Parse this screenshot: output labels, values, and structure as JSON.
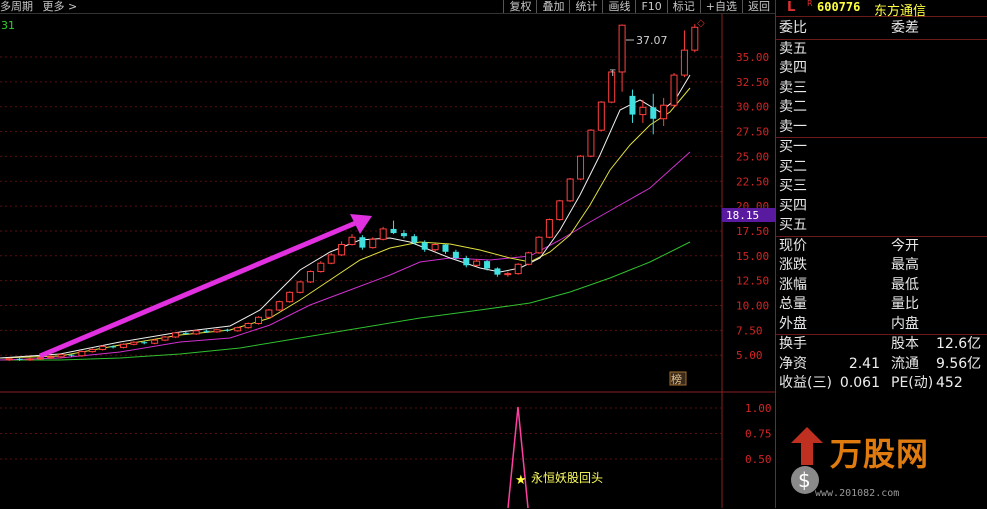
{
  "toolbar": {
    "left": [
      "多周期",
      "更多 >"
    ],
    "buttons": [
      "复权",
      "叠加",
      "统计",
      "画线",
      "F10",
      "标记",
      "+自选",
      "返回"
    ]
  },
  "chart_label_top": "31",
  "price_axis": [
    "35.00",
    "32.50",
    "30.00",
    "27.50",
    "25.00",
    "22.50",
    "20.00",
    "17.50",
    "15.00",
    "12.50",
    "10.00",
    "7.50",
    "5.00"
  ],
  "current_price_tag": "18.15",
  "high_annotation": "37.07",
  "t_marker": "T",
  "bang_badge": "榜",
  "indicator_axis": [
    "1.00",
    "0.75",
    "0.50"
  ],
  "signal_text": "永恒妖股回头",
  "colors": {
    "up_candle": "#ff4040",
    "down_candle": "#40e0e0",
    "ma5": "#ffffff",
    "ma10": "#ffff40",
    "ma20": "#ff40ff",
    "ma60": "#40d040",
    "arrow": "#e030e0",
    "signal": "#ff40a0"
  },
  "chart_data": {
    "type": "candlestick",
    "y_range": [
      4.5,
      37.5
    ],
    "ma_lines": [
      "white",
      "yellow",
      "magenta",
      "green"
    ],
    "indicator_range": [
      0.4,
      1.05
    ],
    "indicator_peak": 1.0
  },
  "panel": {
    "label_L": "L",
    "label_R": "R",
    "code": "600776",
    "name": "东方通信",
    "header_row": {
      "left": "委比",
      "mid": "委差"
    },
    "asks": [
      "卖五",
      "卖四",
      "卖三",
      "卖二",
      "卖一"
    ],
    "bids": [
      "买一",
      "买二",
      "买三",
      "买四",
      "买五"
    ],
    "quote_rows": [
      {
        "left": "现价",
        "mid": "今开"
      },
      {
        "left": "涨跌",
        "mid": "最高"
      },
      {
        "left": "涨幅",
        "mid": "最低"
      },
      {
        "left": "总量",
        "mid": "量比"
      },
      {
        "left": "外盘",
        "mid": "内盘"
      }
    ],
    "fin_rows": [
      {
        "left": "换手",
        "v1": "",
        "mid": "股本",
        "v2": "12.6亿"
      },
      {
        "left": "净资",
        "v1": "2.41",
        "mid": "流通",
        "v2": "9.56亿"
      },
      {
        "left": "收益(三)",
        "v1": "0.061",
        "mid": "PE(动)",
        "v2": "452"
      }
    ]
  },
  "watermark": {
    "text": "万股网",
    "url": "www.201082.com"
  }
}
